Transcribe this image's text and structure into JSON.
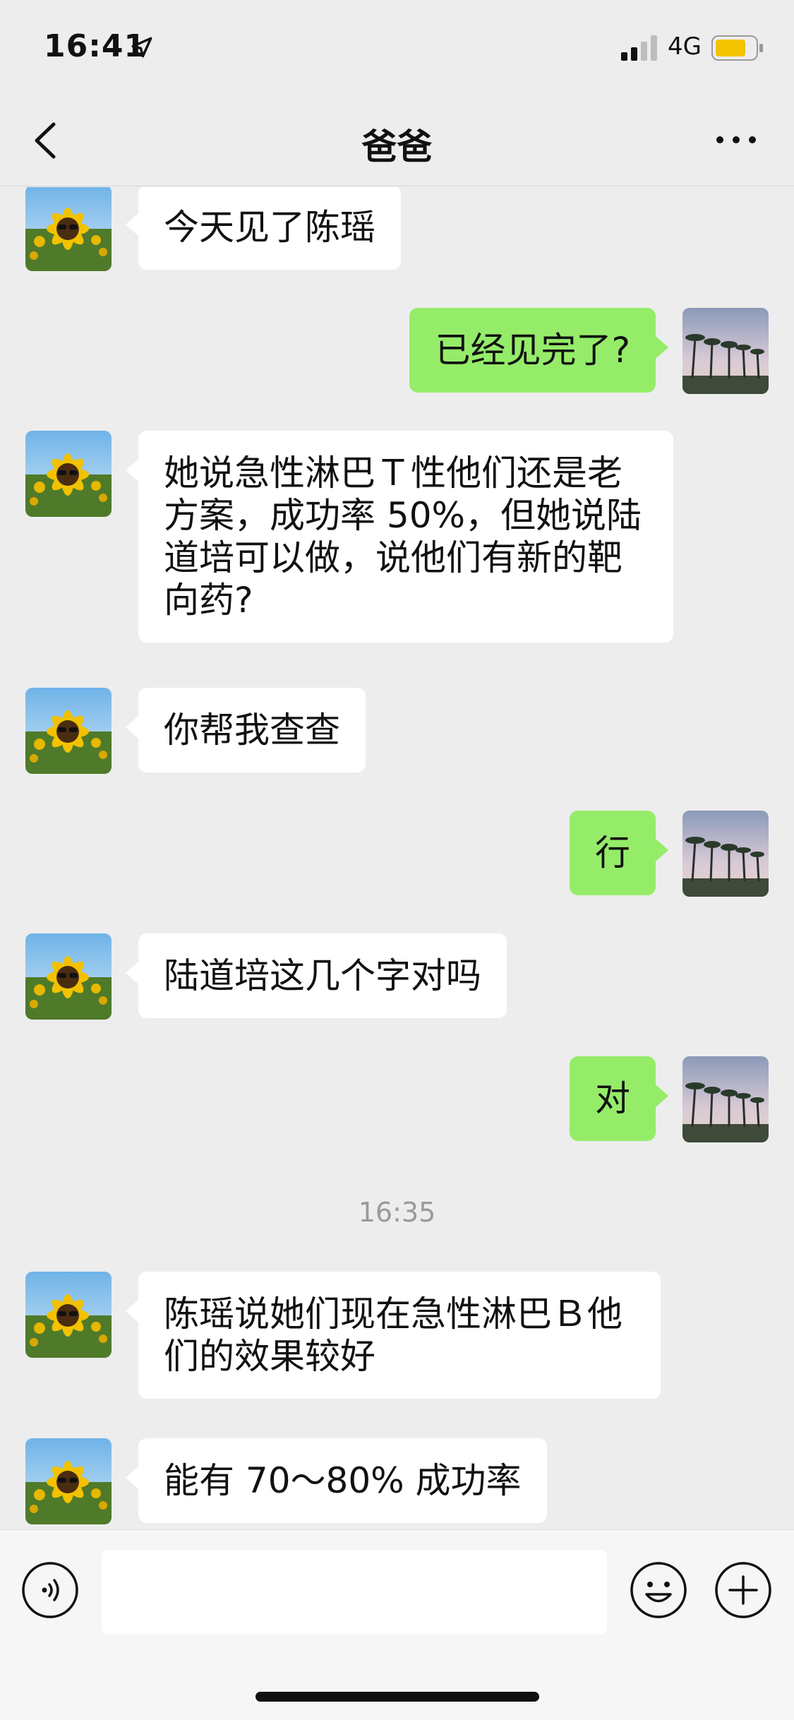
{
  "status_bar": {
    "time": "16:41",
    "network": "4G",
    "battery_color": "#f5c400"
  },
  "nav": {
    "title": "爸爸",
    "back_icon": "chevron-left-icon",
    "more_icon": "more-dots-icon"
  },
  "colors": {
    "background": "#ededed",
    "incoming_bubble": "#ffffff",
    "outgoing_bubble": "#95ec69"
  },
  "messages": [
    {
      "side": "left",
      "text": "今天见了陈瑶"
    },
    {
      "side": "right",
      "text": "已经见完了?"
    },
    {
      "side": "left",
      "text": "她说急性淋巴Ｔ性他们还是老\n方案，成功率 50%，但她说陆\n道培可以做，说他们有新的靶\n向药?"
    },
    {
      "side": "left",
      "text": "你帮我查查"
    },
    {
      "side": "right",
      "text": "行"
    },
    {
      "side": "left",
      "text": "陆道培这几个字对吗"
    },
    {
      "side": "right",
      "text": "对"
    },
    {
      "type": "timestamp",
      "text": "16:35"
    },
    {
      "side": "left",
      "text": "陈瑶说她们现在急性淋巴Ｂ他\n们的效果较好"
    },
    {
      "side": "left",
      "text": "能有 70～80% 成功率"
    }
  ],
  "input_bar": {
    "voice_icon": "voice-icon",
    "input_value": "",
    "emoji_icon": "emoji-icon",
    "plus_icon": "plus-icon"
  }
}
